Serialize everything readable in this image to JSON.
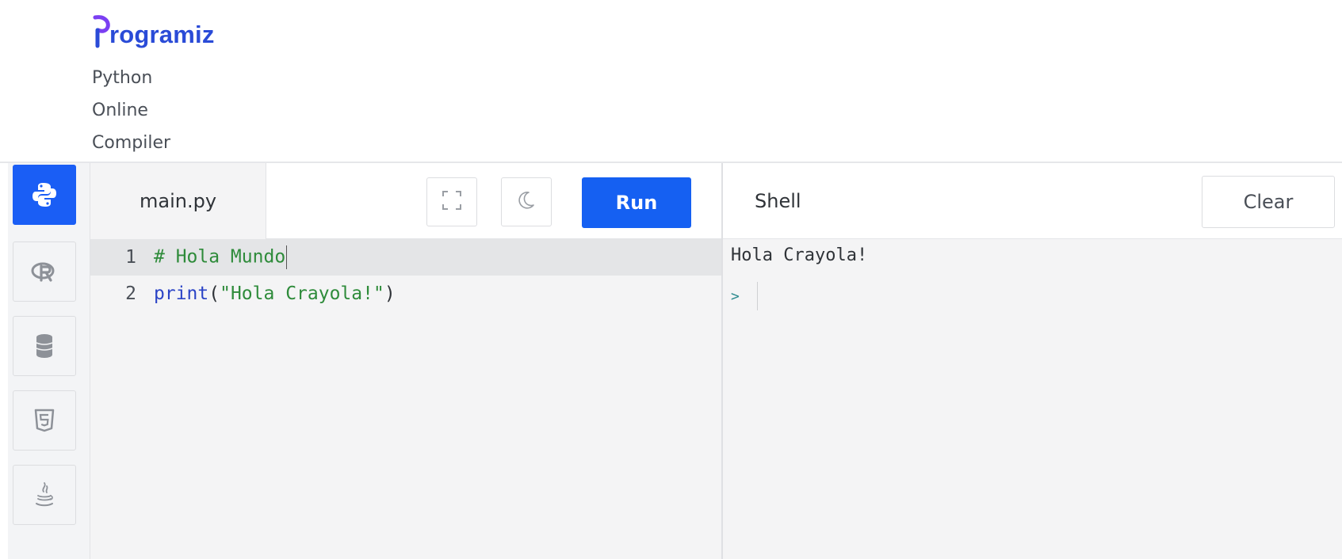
{
  "header": {
    "brand": "rogramiz",
    "subtitle": "Python Online Compiler"
  },
  "sidebar": {
    "items": [
      {
        "icon": "python-icon",
        "active": true
      },
      {
        "icon": "r-language-icon",
        "active": false
      },
      {
        "icon": "database-icon",
        "active": false
      },
      {
        "icon": "html5-icon",
        "active": false
      },
      {
        "icon": "java-icon",
        "active": false
      }
    ]
  },
  "editor": {
    "file_tab": "main.py",
    "fullscreen_icon": "fullscreen-icon",
    "theme_icon": "moon-icon",
    "run_label": "Run",
    "lines": [
      {
        "number": "1",
        "comment": "# Hola Mundo"
      },
      {
        "number": "2",
        "builtin": "print",
        "open": "(",
        "string": "\"Hola Crayola!\"",
        "close": ")"
      }
    ]
  },
  "shell": {
    "title": "Shell",
    "clear_label": "Clear",
    "output": "Hola Crayola!",
    "prompt": ">"
  },
  "colors": {
    "brand": "#2a4bd7",
    "run_button": "#1560f2",
    "active_language": "#1a5ef5",
    "comment": "#2e8b3a",
    "builtin": "#2b44c6"
  }
}
